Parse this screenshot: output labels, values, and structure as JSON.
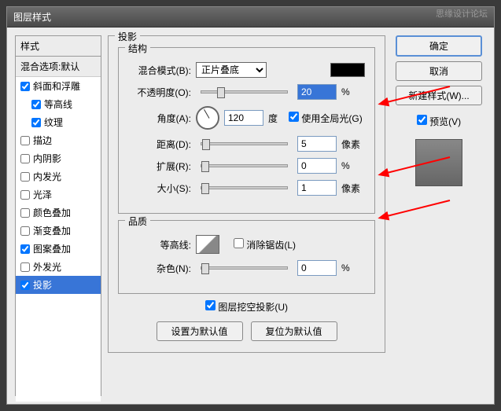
{
  "watermark": "思缘设计论坛",
  "title": "图层样式",
  "styles": {
    "header": "样式",
    "blend_options": "混合选项:默认",
    "items": [
      {
        "label": "斜面和浮雕",
        "checked": true,
        "indent": false
      },
      {
        "label": "等高线",
        "checked": true,
        "indent": true
      },
      {
        "label": "纹理",
        "checked": true,
        "indent": true
      },
      {
        "label": "描边",
        "checked": false,
        "indent": false
      },
      {
        "label": "内阴影",
        "checked": false,
        "indent": false
      },
      {
        "label": "内发光",
        "checked": false,
        "indent": false
      },
      {
        "label": "光泽",
        "checked": false,
        "indent": false
      },
      {
        "label": "颜色叠加",
        "checked": false,
        "indent": false
      },
      {
        "label": "渐变叠加",
        "checked": false,
        "indent": false
      },
      {
        "label": "图案叠加",
        "checked": true,
        "indent": false
      },
      {
        "label": "外发光",
        "checked": false,
        "indent": false
      },
      {
        "label": "投影",
        "checked": true,
        "indent": false,
        "selected": true
      }
    ]
  },
  "shadow": {
    "panel_title": "投影",
    "structure_title": "结构",
    "blend_mode_label": "混合模式(B):",
    "blend_mode_value": "正片叠底",
    "opacity_label": "不透明度(O):",
    "opacity_value": "20",
    "opacity_unit": "%",
    "angle_label": "角度(A):",
    "angle_value": "120",
    "angle_unit": "度",
    "global_light_label": "使用全局光(G)",
    "global_light_checked": true,
    "distance_label": "距离(D):",
    "distance_value": "5",
    "distance_unit": "像素",
    "spread_label": "扩展(R):",
    "spread_value": "0",
    "spread_unit": "%",
    "size_label": "大小(S):",
    "size_value": "1",
    "size_unit": "像素",
    "quality_title": "品质",
    "contour_label": "等高线:",
    "antialias_label": "消除锯齿(L)",
    "antialias_checked": false,
    "noise_label": "杂色(N):",
    "noise_value": "0",
    "noise_unit": "%",
    "knockout_label": "图层挖空投影(U)",
    "knockout_checked": true,
    "set_default": "设置为默认值",
    "reset_default": "复位为默认值"
  },
  "buttons": {
    "ok": "确定",
    "cancel": "取消",
    "new_style": "新建样式(W)...",
    "preview_label": "预览(V)",
    "preview_checked": true
  }
}
